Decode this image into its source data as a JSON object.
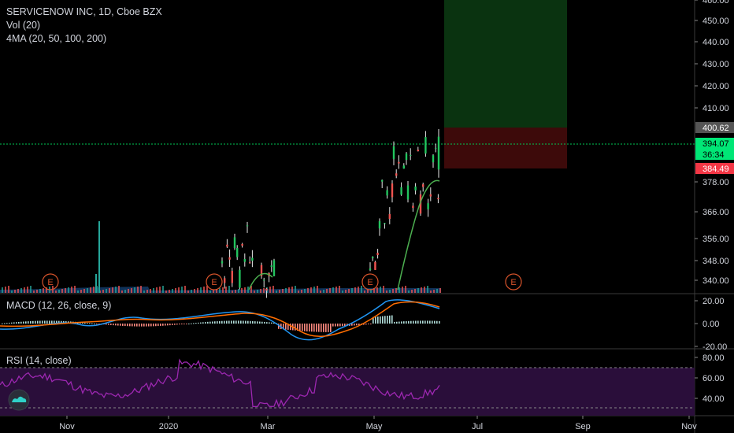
{
  "legend": {
    "title": "SERVICENOW INC, 1D, Cboe BZX",
    "vol": "Vol (20)",
    "ma": "4MA (20, 50, 100, 200)",
    "macd": "MACD (12, 26, close, 9)",
    "rsi": "RSI (14, close)"
  },
  "colors": {
    "background": "#000000",
    "up": "#26a69a",
    "up_candle": "#4caf50",
    "candle_up": "#22c55e",
    "candle_down": "#ef5350",
    "axis_text": "#d1d4dc",
    "divider": "#3a3a3a",
    "current_price_line": "#00c853",
    "stop_zone": "#3d0a0a",
    "target_zone": "#0a3310",
    "vol_area": "#1e5aa0",
    "ma_line": "#4caf50",
    "macd_line": "#2196f3",
    "signal_line": "#ff6d00",
    "hist_pos": "#b2dfdb",
    "hist_neg": "#ff8a80",
    "rsi_line": "#9c27b0",
    "rsi_band": "#2a0e3a",
    "earnings": "#d9542b"
  },
  "price_labels": {
    "top": "400.62",
    "current": "394.07",
    "countdown": "36:34",
    "stop": "384.49"
  },
  "earnings_marker": "E",
  "logo_icon": "tradingview-cloud-icon",
  "chart_data": [
    {
      "type": "candlestick",
      "pane": "price",
      "title": "SERVICENOW INC, 1D, Cboe BZX",
      "y_ticks": [
        340,
        348,
        356,
        366,
        378,
        410,
        420,
        430,
        440,
        450,
        460
      ],
      "y_tick_labels": [
        "340.00",
        "348.00",
        "356.00",
        "366.00",
        "378.00",
        "410.00",
        "420.00",
        "430.00",
        "440.00",
        "450.00",
        "460.00"
      ],
      "current_price": 394.07,
      "position": {
        "entry": 394.07,
        "stop": 384.49,
        "target": 400.62
      },
      "x_ticks": [
        "Nov",
        "2020",
        "Mar",
        "May",
        "Jul",
        "Sep",
        "Nov"
      ],
      "earnings_count": 4,
      "candles_visible_from": "Feb",
      "candles_visible_to": "May"
    },
    {
      "type": "line",
      "pane": "macd",
      "title": "MACD (12, 26, close, 9)",
      "y_ticks": [
        20,
        0,
        -20
      ],
      "y_tick_labels": [
        "20.00",
        "0.00",
        "-20.00"
      ],
      "series": [
        {
          "name": "MACD"
        },
        {
          "name": "Signal"
        },
        {
          "name": "Histogram"
        }
      ]
    },
    {
      "type": "line",
      "pane": "rsi",
      "title": "RSI (14, close)",
      "y_ticks": [
        80,
        60,
        40
      ],
      "y_tick_labels": [
        "80.00",
        "60.00",
        "40.00"
      ],
      "bands": [
        70,
        30
      ]
    }
  ]
}
